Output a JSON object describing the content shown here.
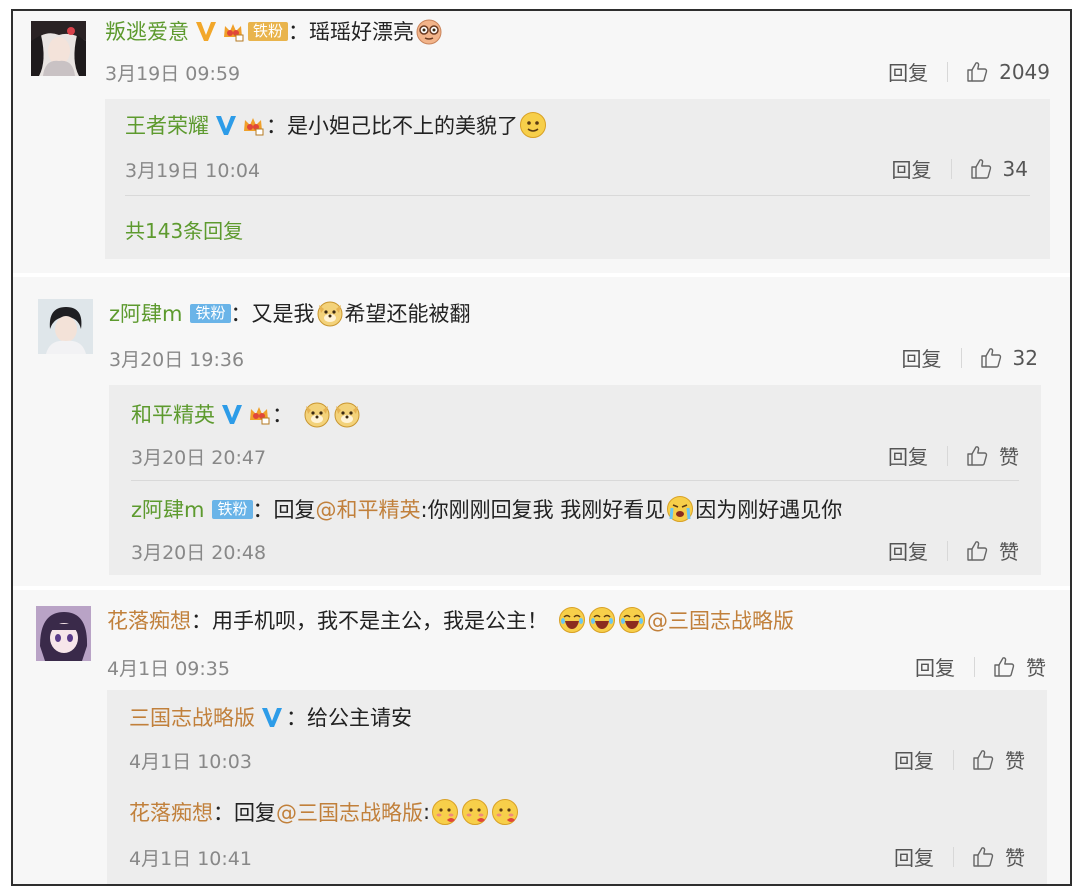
{
  "threads": [
    {
      "user": "叛逃爱意",
      "fan_label": "铁粉",
      "colon": "：",
      "text": "瑶瑶好漂亮",
      "time": "3月19日 09:59",
      "reply_label": "回复",
      "likes": "2049",
      "replies": [
        {
          "user": "王者荣耀",
          "colon": "：",
          "text": "是小妲己比不上的美貌了",
          "time": "3月19日 10:04",
          "reply_label": "回复",
          "likes": "34"
        }
      ],
      "total_replies": "共143条回复"
    },
    {
      "user": "z阿肆m",
      "fan_label": "铁粉",
      "colon": "：",
      "text_before": "又是我",
      "text_after": "希望还能被翻",
      "time": "3月20日 19:36",
      "reply_label": "回复",
      "likes": "32",
      "replies": [
        {
          "user": "和平精英",
          "colon": "：",
          "time": "3月20日 20:47",
          "reply_label": "回复",
          "likes": "赞"
        },
        {
          "user": "z阿肆m",
          "fan_label": "铁粉",
          "colon": "：",
          "reply_prefix": "回复",
          "mention": "@和平精英",
          "text_before": ":你刚刚回复我 我刚好看见",
          "text_after": "因为刚好遇见你",
          "time": "3月20日 20:48",
          "reply_label": "回复",
          "likes": "赞"
        }
      ]
    },
    {
      "user": "花落痴想",
      "colon": "：",
      "text": "用手机呗，我不是主公，我是公主！",
      "mention": "@三国志战略版",
      "time": "4月1日 09:35",
      "reply_label": "回复",
      "likes": "赞",
      "replies": [
        {
          "user": "三国志战略版",
          "colon": "：",
          "text": "给公主请安",
          "time": "4月1日 10:03",
          "reply_label": "回复",
          "likes": "赞"
        },
        {
          "user": "花落痴想",
          "colon": "：",
          "reply_prefix": "回复",
          "mention": "@三国志战略版",
          "text_after": ":",
          "time": "4月1日 10:41",
          "reply_label": "回复",
          "likes": "赞"
        }
      ]
    }
  ],
  "icons": {
    "verified": "verified-v-icon",
    "crown": "crown-badge-icon",
    "like": "thumbs-up-icon"
  },
  "colors": {
    "username_green": "#5d9a2e",
    "username_orange": "#c1803b",
    "verified_blue": "#2d9ce8",
    "verified_gold": "#f2a72a",
    "fan_gold": "#e9b44c",
    "fan_blue": "#6ab4e8"
  }
}
